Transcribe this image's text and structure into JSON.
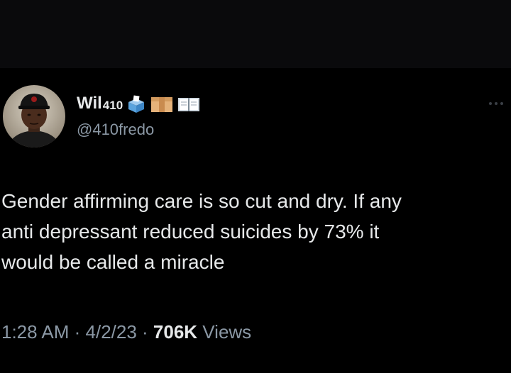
{
  "tweet": {
    "author": {
      "display_name": "Wil",
      "display_name_suffix": "410",
      "name_icons": [
        "ballot-box-icon",
        "package-icon",
        "open-book-icon"
      ],
      "handle": "@410fredo",
      "avatar": "avatar"
    },
    "text": "Gender affirming care is so cut and dry. If any\nanti depressant reduced suicides by 73% it\nwould be called a miracle",
    "time": "1:28 AM",
    "separator": " · ",
    "date": "4/2/23",
    "views_count": "706K",
    "views_label": " Views",
    "more_icon": "more-options-icon"
  },
  "colors": {
    "background": "#000000",
    "top_band": "#0a0a0c",
    "primary_text": "#e7e9ea",
    "secondary_text": "#8b98a5"
  }
}
